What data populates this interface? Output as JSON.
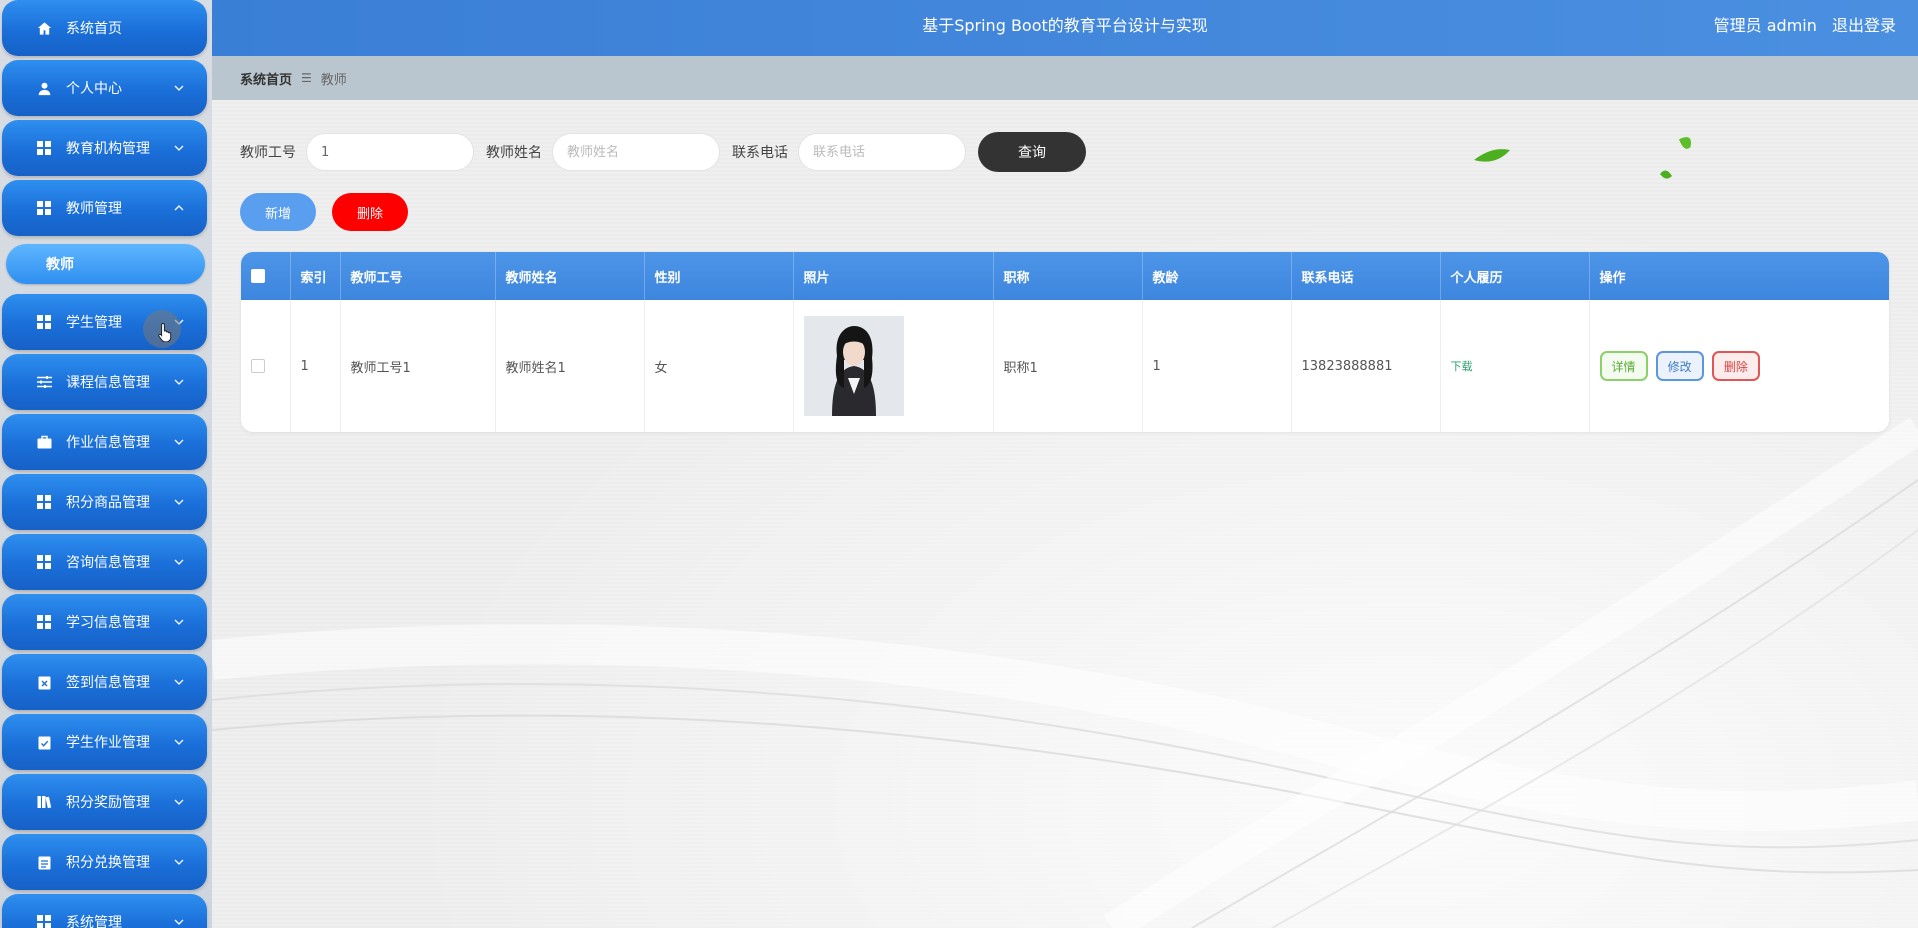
{
  "header": {
    "title": "基于Spring Boot的教育平台设计与实现",
    "user_label": "管理员 admin",
    "logout_label": "退出登录"
  },
  "breadcrumb": {
    "home": "系统首页",
    "separator": "☰",
    "current": "教师"
  },
  "sidebar": {
    "items": [
      {
        "label": "系统首页",
        "icon": "home-icon"
      },
      {
        "label": "个人中心",
        "icon": "user-icon"
      },
      {
        "label": "教育机构管理",
        "icon": "grid-icon"
      },
      {
        "label": "教师管理",
        "icon": "grid-icon",
        "expanded": true
      },
      {
        "label": "学生管理",
        "icon": "grid-icon"
      },
      {
        "label": "课程信息管理",
        "icon": "sliders-icon"
      },
      {
        "label": "作业信息管理",
        "icon": "briefcase-icon"
      },
      {
        "label": "积分商品管理",
        "icon": "grid-icon"
      },
      {
        "label": "咨询信息管理",
        "icon": "grid-icon"
      },
      {
        "label": "学习信息管理",
        "icon": "grid-icon"
      },
      {
        "label": "签到信息管理",
        "icon": "clipboard-x-icon"
      },
      {
        "label": "学生作业管理",
        "icon": "clipboard-check-icon"
      },
      {
        "label": "积分奖励管理",
        "icon": "book-icon"
      },
      {
        "label": "积分兑换管理",
        "icon": "clipboard-icon"
      },
      {
        "label": "系统管理",
        "icon": "grid-icon"
      }
    ],
    "submenu": {
      "label": "教师"
    }
  },
  "search": {
    "teacher_no_label": "教师工号",
    "teacher_no_value": "1",
    "teacher_name_label": "教师姓名",
    "teacher_name_placeholder": "教师姓名",
    "phone_label": "联系电话",
    "phone_placeholder": "联系电话",
    "query_label": "查询"
  },
  "actions": {
    "add_label": "新增",
    "delete_label": "删除"
  },
  "table": {
    "columns": [
      "索引",
      "教师工号",
      "教师姓名",
      "性别",
      "照片",
      "职称",
      "教龄",
      "联系电话",
      "个人履历",
      "操作"
    ],
    "rows": [
      {
        "index": "1",
        "teacher_no": "教师工号1",
        "teacher_name": "教师姓名1",
        "gender": "女",
        "title": "职称1",
        "years": "1",
        "phone": "13823888881",
        "resume_link": "下载",
        "op_detail": "详情",
        "op_edit": "修改",
        "op_delete": "删除"
      }
    ]
  },
  "colors": {
    "sidebar_item": "#1a6fd8",
    "header": "#3a7fd6",
    "table_header": "#4d95e8",
    "delete_red": "#ff0000",
    "query_dark": "#333333"
  }
}
